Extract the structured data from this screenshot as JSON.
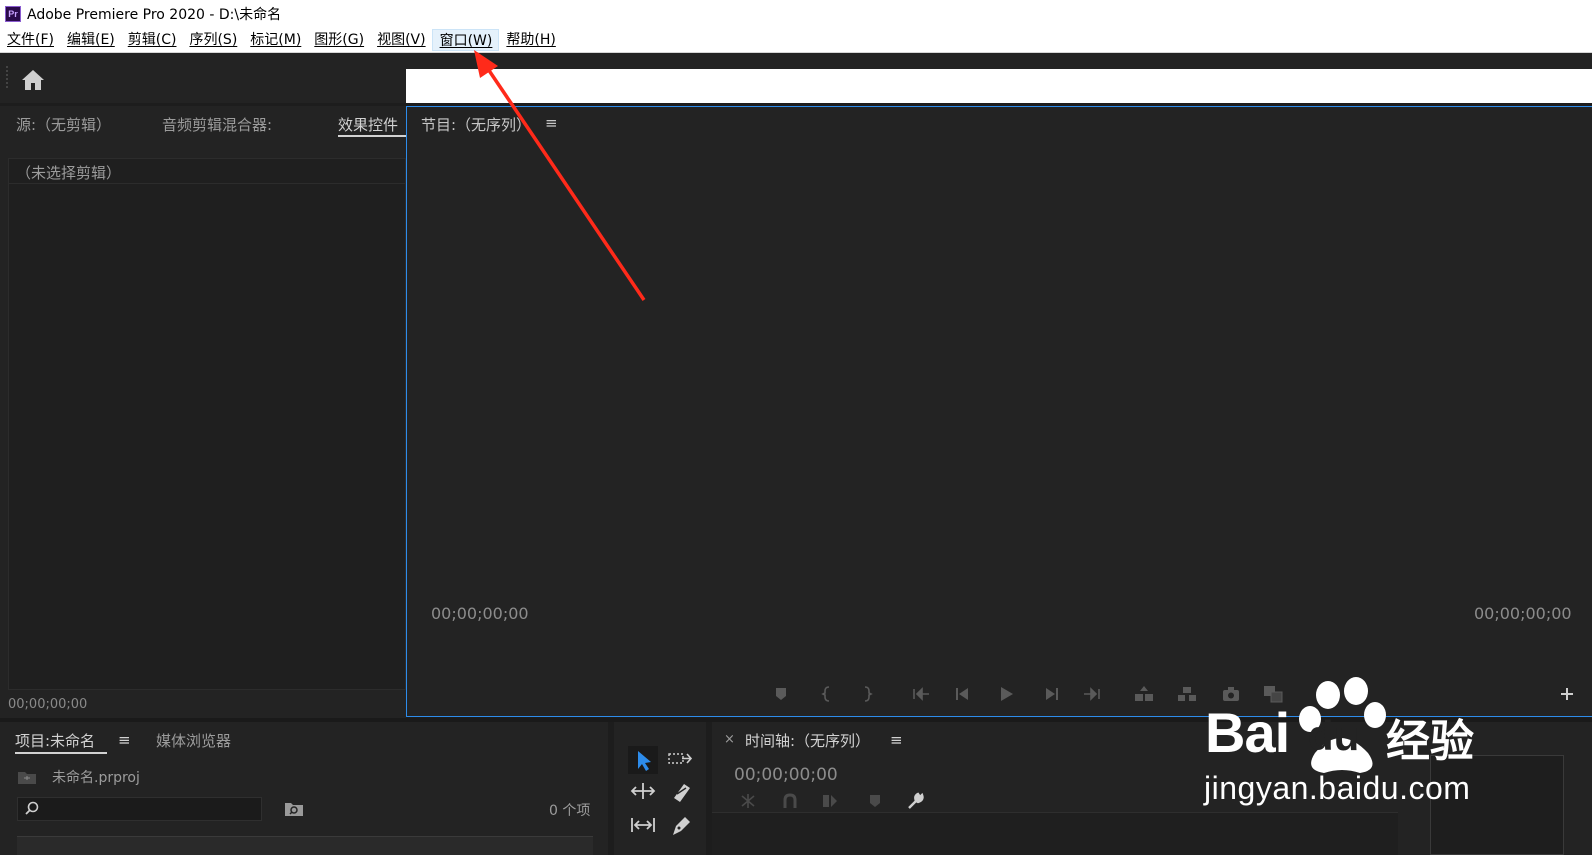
{
  "window": {
    "app_icon_label": "Pr",
    "title": "Adobe Premiere Pro 2020 - D:\\未命名"
  },
  "menubar": {
    "items": [
      {
        "label": "文件(F)"
      },
      {
        "label": "编辑(E)"
      },
      {
        "label": "剪辑(C)"
      },
      {
        "label": "序列(S)"
      },
      {
        "label": "标记(M)"
      },
      {
        "label": "图形(G)"
      },
      {
        "label": "视图(V)"
      },
      {
        "label": "窗口(W)"
      },
      {
        "label": "帮助(H)"
      }
    ],
    "highlighted": "窗口(W)"
  },
  "source_panel": {
    "tabs": [
      {
        "label": "源:（无剪辑）"
      },
      {
        "label": "音频剪辑混合器:"
      },
      {
        "label": "效果控件"
      }
    ],
    "empty_label": "（未选择剪辑）",
    "timecode": "00;00;00;00"
  },
  "program_panel": {
    "title": "节目:（无序列）",
    "menu_icon": "≡",
    "timecode_left": "00;00;00;00",
    "timecode_right": "00;00;00;00",
    "controls": [
      "marker-icon",
      "mark-in-icon",
      "mark-out-icon",
      "go-to-in-icon",
      "step-back-icon",
      "play-icon",
      "step-forward-icon",
      "go-to-out-icon",
      "lift-icon",
      "extract-icon",
      "export-frame-icon",
      "comparison-view-icon",
      "add-button-icon"
    ]
  },
  "project_panel": {
    "tab_label": "项目:未命名",
    "menu_icon": "≡",
    "media_browser_label": "媒体浏览器",
    "file_name": "未命名.prproj",
    "search_placeholder": "",
    "item_count": "0 个项"
  },
  "timeline_panel": {
    "close_label": "×",
    "title": "时间轴:（无序列）",
    "menu_icon": "≡",
    "timecode": "00;00;00;00"
  },
  "watermark": {
    "brand": "Bai",
    "brand_tail": "du",
    "cn": "经验",
    "url": "jingyan.baidu.com"
  },
  "colors": {
    "panel_bg": "#232323",
    "focus_border": "#2d8ceb",
    "annotation_arrow": "#ff2a1a",
    "selection_tool": "#2d8ceb"
  }
}
